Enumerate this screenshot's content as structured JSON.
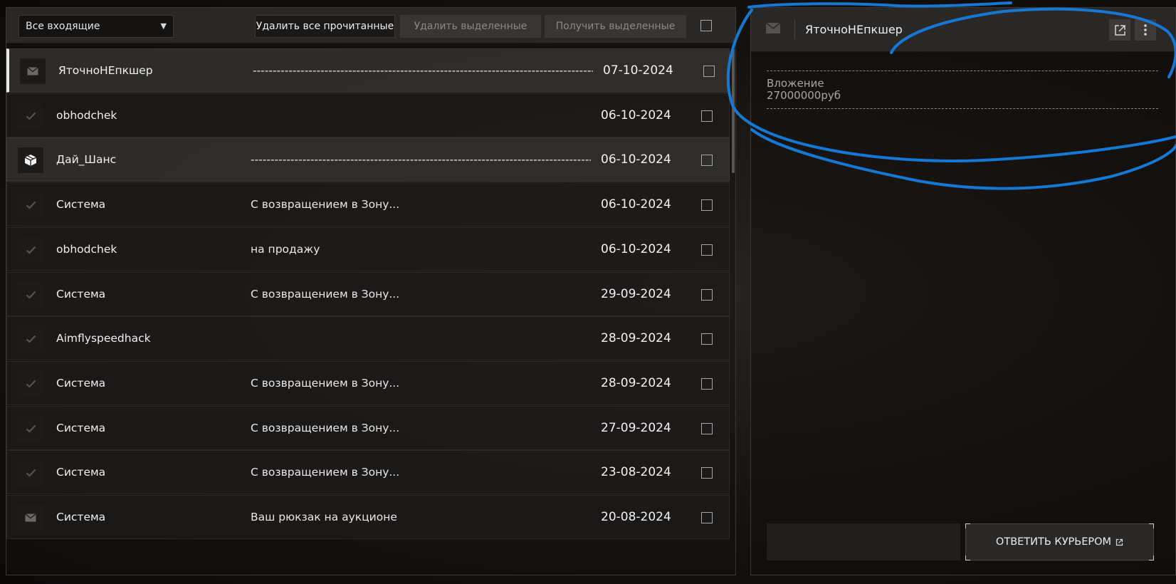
{
  "toolbar": {
    "folder_select": "Все входящие",
    "delete_read": "Удалить все прочитанные",
    "delete_selected": "Удалить выделенные",
    "receive_selected": "Получить выделенные"
  },
  "messages": [
    {
      "sender": "ЯточноНЕпкшер",
      "subject": "------------------------------------------------------------------------------------------..",
      "date": "07-10-2024",
      "icon": "envelope-icon",
      "state": "selected"
    },
    {
      "sender": "obhodchek",
      "subject": "",
      "date": "06-10-2024",
      "icon": "check-icon",
      "state": "read"
    },
    {
      "sender": "Дай_Шанс",
      "subject": "------------------------------------------------------------------------------------------..",
      "date": "06-10-2024",
      "icon": "package-icon",
      "state": "unread"
    },
    {
      "sender": "Система",
      "subject": "С возвращением в Зону...",
      "date": "06-10-2024",
      "icon": "check-icon",
      "state": "read"
    },
    {
      "sender": "obhodchek",
      "subject": "на продажу",
      "date": "06-10-2024",
      "icon": "check-icon",
      "state": "read"
    },
    {
      "sender": "Система",
      "subject": "С возвращением в Зону...",
      "date": "29-09-2024",
      "icon": "check-icon",
      "state": "read"
    },
    {
      "sender": "Aimflyspeedhack",
      "subject": "",
      "date": "28-09-2024",
      "icon": "check-icon",
      "state": "read"
    },
    {
      "sender": "Система",
      "subject": "С возвращением в Зону...",
      "date": "28-09-2024",
      "icon": "check-icon",
      "state": "read"
    },
    {
      "sender": "Система",
      "subject": "С возвращением в Зону...",
      "date": "27-09-2024",
      "icon": "check-icon",
      "state": "read"
    },
    {
      "sender": "Система",
      "subject": "С возвращением в Зону...",
      "date": "23-08-2024",
      "icon": "check-icon",
      "state": "read"
    },
    {
      "sender": "Система",
      "subject": "Ваш рюкзак на аукционе",
      "date": "20-08-2024",
      "icon": "envelope-icon",
      "state": "read"
    }
  ],
  "viewer": {
    "title": "ЯточноНЕпкшер",
    "body_line1": "Вложение",
    "body_line2": "27000000руб",
    "reply_button": "ОТВЕТИТЬ КУРЬЕРОМ"
  },
  "colors": {
    "annotation_stroke": "#1478d4",
    "panel_header": "#2a2827"
  }
}
